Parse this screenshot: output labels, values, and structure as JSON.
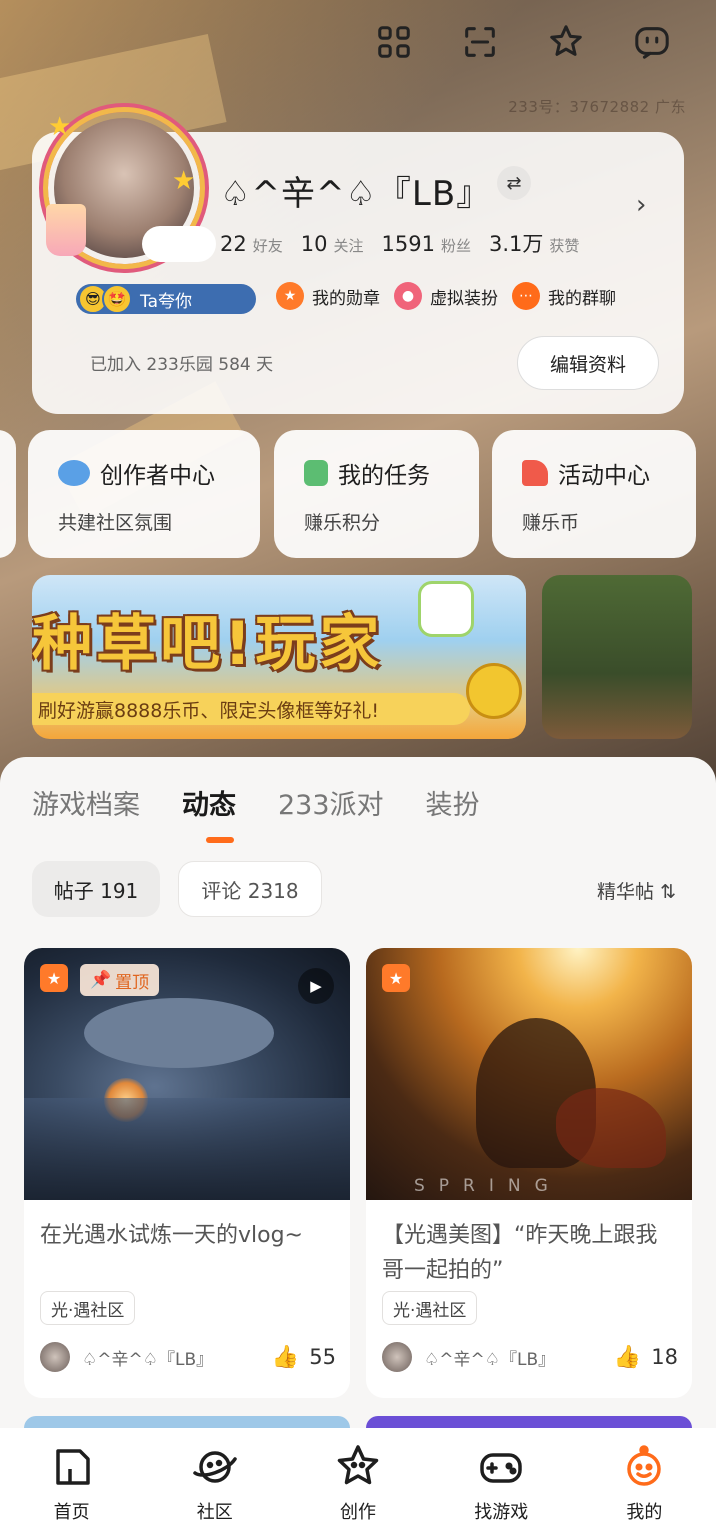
{
  "header": {
    "user_id_text": "233号：37672882  广东",
    "icons": [
      "apps-grid-icon",
      "scan-icon",
      "star-sparkle-icon",
      "message-icon"
    ]
  },
  "profile": {
    "nickname": "♤^辛^♤『LB』",
    "switch_symbol": "⇄",
    "arrow": "›",
    "stats": [
      {
        "num": "22",
        "label": "好友"
      },
      {
        "num": "10",
        "label": "关注"
      },
      {
        "num": "1591",
        "label": "粉丝"
      },
      {
        "num": "3.1万",
        "label": "获赞"
      }
    ],
    "praise_badge": "Ta夸你",
    "quick_links": [
      {
        "label": "我的勋章",
        "icon": "medal-icon",
        "color": "#ff7a2a"
      },
      {
        "label": "虚拟装扮",
        "icon": "dressup-icon",
        "color": "#f0647a"
      },
      {
        "label": "我的群聊",
        "icon": "group-chat-icon",
        "color": "#ff6b1a"
      }
    ],
    "join_text": "已加入 233乐园 584 天",
    "edit_button": "编辑资料"
  },
  "features": [
    {
      "title": "创作者中心",
      "sub": "共建社区氛围",
      "icon": "planet-icon",
      "color": "#5aa0e6"
    },
    {
      "title": "我的任务",
      "sub": "赚乐积分",
      "icon": "task-book-icon",
      "color": "#5cbd72"
    },
    {
      "title": "活动中心",
      "sub": "赚乐币",
      "icon": "party-popper-icon",
      "color": "#f05a4a"
    }
  ],
  "banner": {
    "title": "种草吧!玩家",
    "subtitle": "刷好游赢8888乐币、限定头像框等好礼!"
  },
  "tabs": [
    {
      "label": "游戏档案",
      "active": false
    },
    {
      "label": "动态",
      "active": true
    },
    {
      "label": "233派对",
      "active": false
    },
    {
      "label": "装扮",
      "active": false
    }
  ],
  "filters": {
    "posts": "帖子 191",
    "comments": "评论 2318",
    "sort": "精华帖 ⇅"
  },
  "posts": [
    {
      "title": "在光遇水试炼一天的vlog~",
      "tag": "光·遇社区",
      "author": "♤^辛^♤『LB』",
      "likes": "55",
      "pin_label": "置顶",
      "has_video": true
    },
    {
      "title": "【光遇美图】“昨天晚上跟我哥一起拍的”",
      "tag": "光·遇社区",
      "author": "♤^辛^♤『LB』",
      "likes": "18",
      "image_text": "SPRING",
      "has_video": false
    }
  ],
  "bottom_nav": [
    {
      "label": "首页",
      "icon": "home-icon"
    },
    {
      "label": "社区",
      "icon": "community-planet-icon"
    },
    {
      "label": "创作",
      "icon": "create-star-icon"
    },
    {
      "label": "找游戏",
      "icon": "gamepad-icon"
    },
    {
      "label": "我的",
      "icon": "profile-avatar-icon"
    }
  ],
  "colors": {
    "accent": "#ff6b1a",
    "badge_blue": "#3d6db0"
  }
}
